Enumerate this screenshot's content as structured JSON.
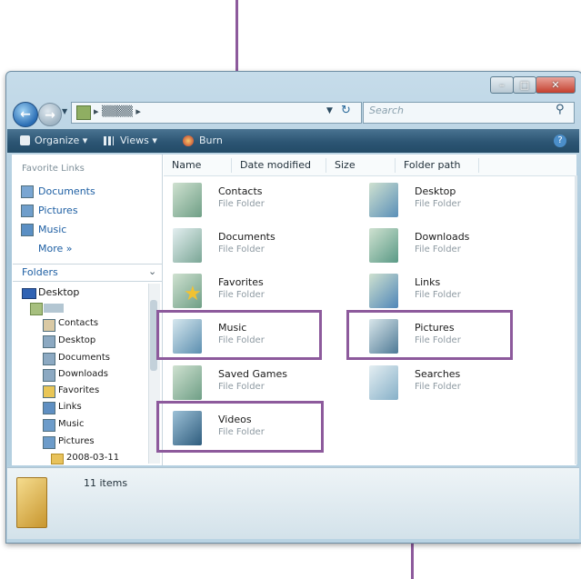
{
  "address": {
    "crumb": "▸ ▒▒▒▒ ▸"
  },
  "search": {
    "placeholder": "Search"
  },
  "toolbar": {
    "organize": "Organize ▾",
    "views": "Views ▾",
    "burn": "Burn"
  },
  "nav": {
    "favorite_links_heading": "Favorite Links",
    "favorites": [
      "Documents",
      "Pictures",
      "Music"
    ],
    "more": "More »",
    "folders_heading": "Folders",
    "tree": [
      "Desktop",
      "Contacts",
      "Desktop",
      "Documents",
      "Downloads",
      "Favorites",
      "Links",
      "Music",
      "Pictures",
      "2008-03-11"
    ]
  },
  "columns": [
    "Name",
    "Date modified",
    "Size",
    "Folder path"
  ],
  "items": [
    {
      "name": "Contacts",
      "type": "File Folder"
    },
    {
      "name": "Desktop",
      "type": "File Folder"
    },
    {
      "name": "Documents",
      "type": "File Folder"
    },
    {
      "name": "Downloads",
      "type": "File Folder"
    },
    {
      "name": "Favorites",
      "type": "File Folder"
    },
    {
      "name": "Links",
      "type": "File Folder"
    },
    {
      "name": "Music",
      "type": "File Folder"
    },
    {
      "name": "Pictures",
      "type": "File Folder"
    },
    {
      "name": "Saved Games",
      "type": "File Folder"
    },
    {
      "name": "Searches",
      "type": "File Folder"
    },
    {
      "name": "Videos",
      "type": "File Folder"
    }
  ],
  "details": {
    "count": "11 items"
  },
  "colors": {
    "callout": "#8d5a9c",
    "toolbar": "#2c5573",
    "link": "#1e5fa3"
  }
}
